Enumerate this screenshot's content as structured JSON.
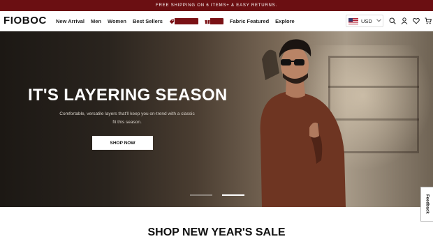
{
  "announcement": "FREE SHIPPING ON 6 ITEMS+ & EASY RETURNS.",
  "header": {
    "logo": "FIOBOC",
    "menu": {
      "new_arrival": "New Arrival",
      "men": "Men",
      "women": "Women",
      "best_sellers": "Best Sellers",
      "fabric_featured": "Fabric Featured",
      "explore": "Explore"
    },
    "promo_icons": [
      "tag-icon",
      "gift-icon"
    ],
    "currency": "USD",
    "icons": [
      "search-icon",
      "user-icon",
      "heart-icon",
      "cart-icon"
    ]
  },
  "hero": {
    "title": "IT'S LAYERING SEASON",
    "subtitle": "Comfortable, versatile layers that'll keep you on-trend with a classic fit this season.",
    "cta": "SHOP NOW",
    "slides": 2,
    "active_slide": 2
  },
  "feedback": "Feedback",
  "section": {
    "title": "SHOP NEW YEAR'S SALE"
  },
  "colors": {
    "brand": "#6b0f12",
    "promo": "#7a1115"
  }
}
